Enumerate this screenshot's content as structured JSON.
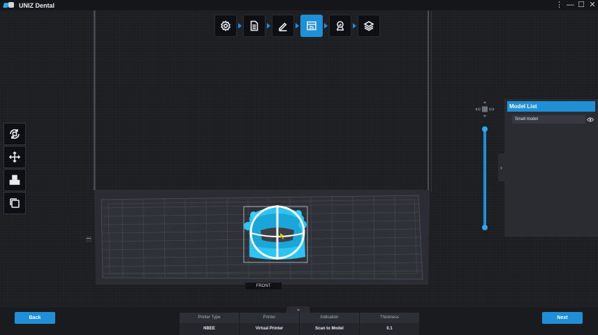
{
  "app": {
    "title": "UNIZ Dental"
  },
  "window_controls": {
    "more": "⋮",
    "minimize": "—",
    "maximize": "☐",
    "close": "✕"
  },
  "steps": [
    {
      "icon": "settings-icon",
      "active": false
    },
    {
      "icon": "document-icon",
      "active": false
    },
    {
      "icon": "pencil-icon",
      "active": false
    },
    {
      "icon": "layout-icon",
      "active": true
    },
    {
      "icon": "support-icon",
      "active": false
    },
    {
      "icon": "layers-icon",
      "active": false
    }
  ],
  "tools": [
    {
      "icon": "rotate-icon"
    },
    {
      "icon": "move-icon"
    },
    {
      "icon": "arrange-icon"
    },
    {
      "icon": "duplicate-icon"
    }
  ],
  "model_list": {
    "title": "Model List",
    "items": [
      {
        "name": "Small model",
        "visible": true
      }
    ]
  },
  "viewport": {
    "front_label": "FRONT",
    "left_tab": "—",
    "collapse_glyph": "›",
    "expand_glyph": "⌄"
  },
  "layer_slider": {
    "top": 1.0,
    "bottom": 0.0
  },
  "footer": {
    "back_label": "Back",
    "next_label": "Next",
    "info": {
      "headers": [
        "Printer Type",
        "Printer",
        "Indication",
        "Thickness"
      ],
      "values": [
        "NBEE",
        "Virtual Printer",
        "Scan to Model",
        "0.1"
      ]
    }
  },
  "colors": {
    "accent": "#1f8fd8",
    "model": "#2ec4f2",
    "background": "#1c1d21"
  }
}
